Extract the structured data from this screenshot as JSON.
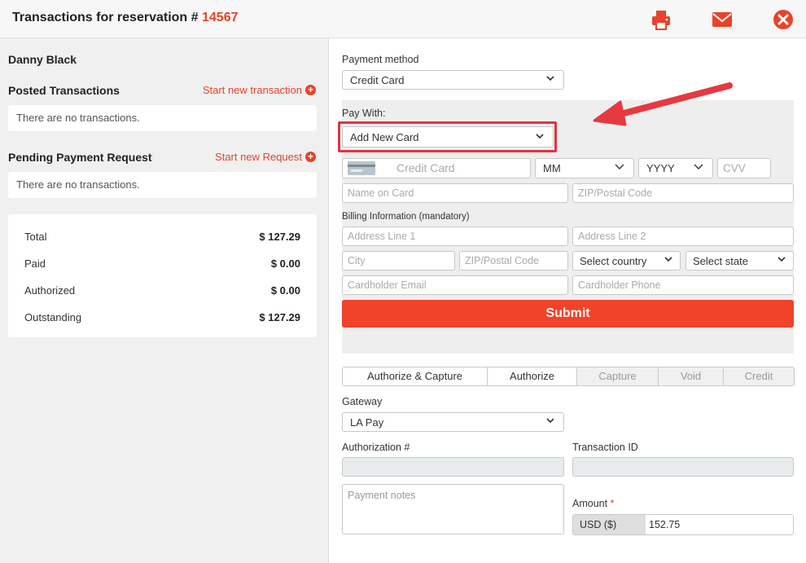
{
  "header": {
    "title": "Transactions for reservation",
    "hash": "#",
    "reservation_number": "14567"
  },
  "left": {
    "guest_name": "Danny Black",
    "posted": {
      "title": "Posted Transactions",
      "link": "Start new transaction",
      "empty": "There are no transactions."
    },
    "pending": {
      "title": "Pending Payment Request",
      "link": "Start new Request",
      "empty": "There are no transactions."
    },
    "totals": [
      {
        "label": "Total",
        "value": "$ 127.29"
      },
      {
        "label": "Paid",
        "value": "$ 0.00"
      },
      {
        "label": "Authorized",
        "value": "$ 0.00"
      },
      {
        "label": "Outstanding",
        "value": "$ 127.29"
      }
    ]
  },
  "right": {
    "payment_method_label": "Payment method",
    "payment_method_value": "Credit Card",
    "pay_with_label": "Pay With:",
    "pay_with_value": "Add New Card",
    "card": {
      "credit_card_placeholder": "Credit Card",
      "mm": "MM",
      "yyyy": "YYYY",
      "cvv_placeholder": "CVV",
      "name_placeholder": "Name on Card",
      "zip_placeholder": "ZIP/Postal Code"
    },
    "billing": {
      "title": "Billing Information (mandatory)",
      "address1": "Address Line 1",
      "address2": "Address Line 2",
      "city": "City",
      "zip": "ZIP/Postal Code",
      "country": "Select country",
      "state": "Select state",
      "email": "Cardholder Email",
      "phone": "Cardholder Phone"
    },
    "submit": "Submit",
    "tabs": [
      {
        "label": "Authorize & Capture",
        "state": "active"
      },
      {
        "label": "Authorize",
        "state": "active"
      },
      {
        "label": "Capture",
        "state": "disabled"
      },
      {
        "label": "Void",
        "state": "disabled"
      },
      {
        "label": "Credit",
        "state": "disabled"
      }
    ],
    "gateway_label": "Gateway",
    "gateway_value": "LA Pay",
    "authorization_label": "Authorization #",
    "transaction_id_label": "Transaction ID",
    "payment_notes_placeholder": "Payment notes",
    "amount_label": "Amount",
    "amount_required_mark": "*",
    "currency": "USD ($)",
    "amount_value": "152.75"
  },
  "colors": {
    "accent": "#e8432a",
    "highlight": "#e0353e"
  }
}
